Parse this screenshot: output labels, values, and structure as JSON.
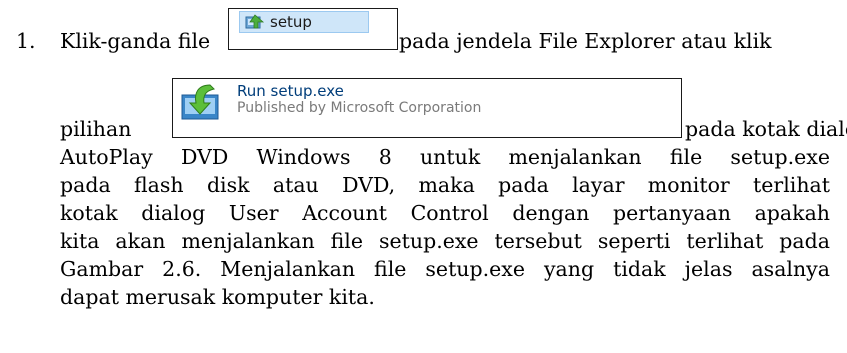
{
  "list": {
    "number": "1."
  },
  "line1": {
    "before": "Klik-ganda file",
    "after": "pada jendela File Explorer atau klik"
  },
  "setup_button": {
    "label": "setup",
    "icon": "setup-installer-icon"
  },
  "line2": {
    "before": "pilihan",
    "after": "pada kotak dialog"
  },
  "autoplay_option": {
    "title": "Run setup.exe",
    "subtitle": "Published by Microsoft Corporation",
    "icon": "install-arrow-icon"
  },
  "body_lines": [
    "AutoPlay DVD Windows 8 untuk menjalankan file setup.exe",
    "pada flash disk atau DVD, maka pada layar monitor terlihat",
    "kotak dialog User Account Control dengan pertanyaan apakah",
    "kita akan menjalankan file setup.exe tersebut seperti terlihat pada",
    "Gambar 2.6. Menjalankan file setup.exe yang tidak jelas asalnya",
    "dapat merusak komputer kita."
  ]
}
